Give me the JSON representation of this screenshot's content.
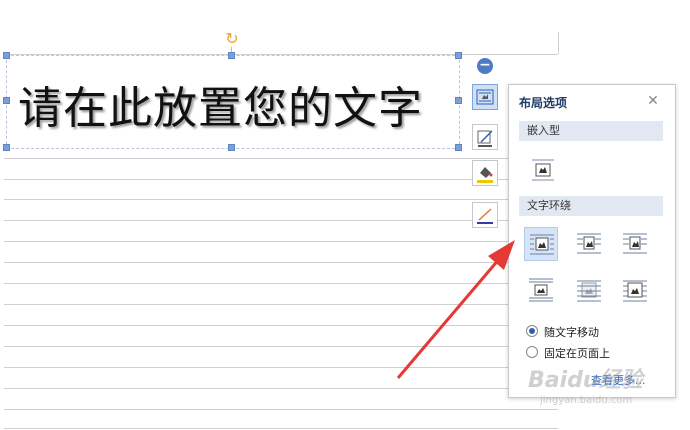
{
  "document": {
    "text_box_content": "请在此放置您的文字"
  },
  "toolbar": {
    "collapse_symbol": "−",
    "tools": [
      {
        "name": "layout-options-icon",
        "active": true
      },
      {
        "name": "shape-outline-icon",
        "active": false
      },
      {
        "name": "fill-color-icon",
        "active": false
      },
      {
        "name": "line-style-icon",
        "active": false
      }
    ]
  },
  "popup": {
    "title": "布局选项",
    "close_symbol": "✕",
    "inline_section": {
      "heading": "嵌入型",
      "options": [
        {
          "name": "inline-with-text-icon",
          "selected": false
        }
      ]
    },
    "wrap_section": {
      "heading": "文字环绕",
      "options": [
        {
          "name": "wrap-square-icon",
          "selected": true
        },
        {
          "name": "wrap-tight-icon",
          "selected": false
        },
        {
          "name": "wrap-through-icon",
          "selected": false
        },
        {
          "name": "wrap-top-bottom-icon",
          "selected": false
        },
        {
          "name": "behind-text-icon",
          "selected": false
        },
        {
          "name": "in-front-of-text-icon",
          "selected": false
        }
      ]
    },
    "radio_options": [
      {
        "label": "随文字移动",
        "checked": true
      },
      {
        "label": "固定在页面上",
        "checked": false
      }
    ],
    "more_link": "查看更多..."
  },
  "watermark": {
    "brand": "Baidu经验",
    "sub": "jingyan.baidu.com"
  },
  "colors": {
    "accent": "#4d7cc6",
    "arrow": "#e53935",
    "selected_option_bg": "#d6e4f7"
  }
}
